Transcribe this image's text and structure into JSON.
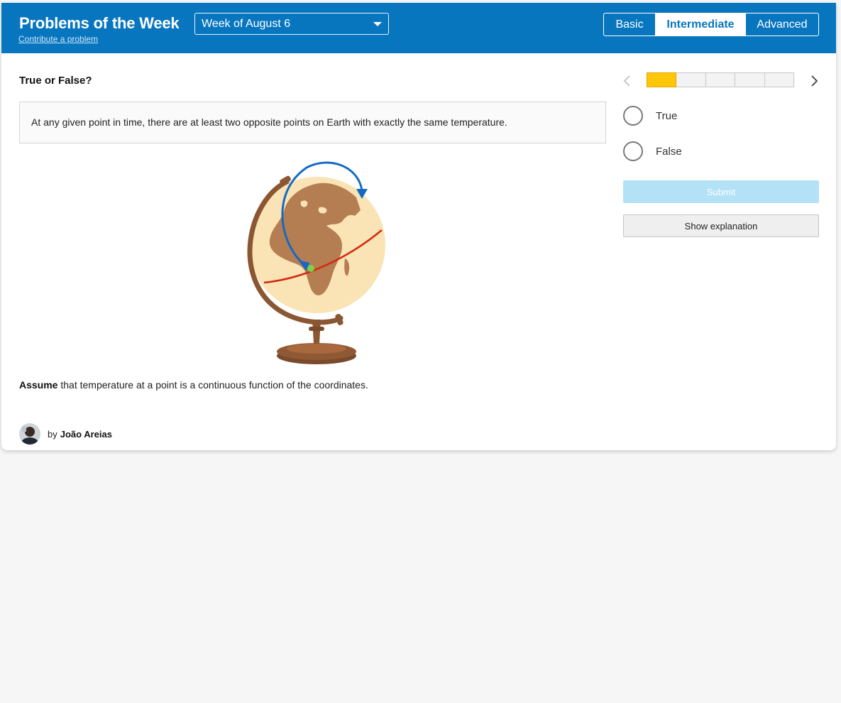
{
  "header": {
    "title": "Problems of the Week",
    "contribute_link": "Contribute a problem",
    "week_select": {
      "selected": "Week of August 6"
    },
    "levels": [
      {
        "label": "Basic",
        "selected": false
      },
      {
        "label": "Intermediate",
        "selected": true
      },
      {
        "label": "Advanced",
        "selected": false
      }
    ]
  },
  "problem": {
    "heading": "True or False?",
    "statement": "At any given point in time, there are at least two opposite points on Earth with exactly the same temperature.",
    "assume_bold": "Assume",
    "assume_text": " that temperature at a point is a continuous function of the coordinates.",
    "image_icon": "globe-illustration",
    "author_prefix": "by",
    "author_name": "João Areias"
  },
  "answer_panel": {
    "progress": {
      "current": 1,
      "total": 5
    },
    "options": [
      "True",
      "False"
    ],
    "submit_label": "Submit",
    "explanation_label": "Show explanation"
  },
  "colors": {
    "header_bg": "#0876bf",
    "progress_fill": "#ffc60a",
    "submit_bg": "#b3e1f6",
    "arrow": "#1669c2",
    "equator": "#d42a10",
    "point": "#7fcf4a"
  }
}
